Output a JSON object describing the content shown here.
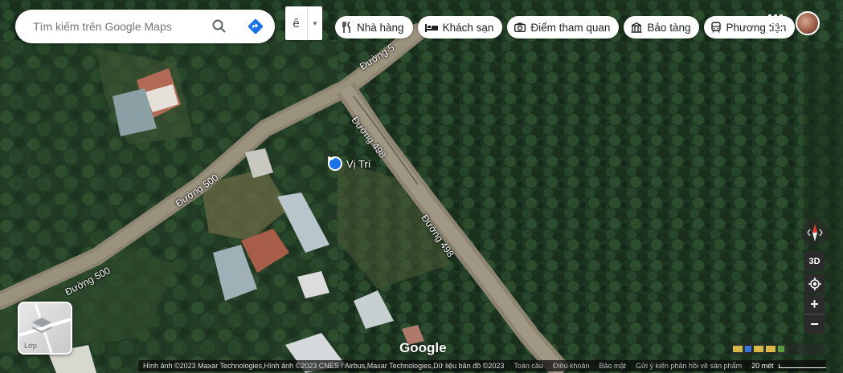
{
  "search": {
    "placeholder": "Tìm kiếm trên Google Maps"
  },
  "layer_dropdown": {
    "glyph": "ê",
    "arrow": "▾"
  },
  "chips": [
    {
      "label": "Nhà hàng",
      "icon": "restaurant-icon"
    },
    {
      "label": "Khách sạn",
      "icon": "hotel-icon"
    },
    {
      "label": "Điểm tham quan",
      "icon": "camera-icon"
    },
    {
      "label": "Bảo tàng",
      "icon": "museum-icon"
    },
    {
      "label": "Phương tiện",
      "icon": "transit-icon"
    }
  ],
  "pin": {
    "label": "Vị Trí",
    "color": "#1a73e8"
  },
  "roads": [
    {
      "name": "Đường 500"
    },
    {
      "name": "Đường 500"
    },
    {
      "name": "Đường 498"
    },
    {
      "name": "Đường 498"
    },
    {
      "name": "Đường 5"
    }
  ],
  "controls": {
    "compass": "compass-icon",
    "three_d": "3D",
    "locate": "my-location-icon",
    "zoom_in": "+",
    "zoom_out": "−"
  },
  "layer_thumb": {
    "label": "Lớp"
  },
  "branding": {
    "logo": "Google"
  },
  "footer": {
    "attribution": "Hình ảnh ©2023 Maxar Technologies,Hình ảnh ©2023 CNES / Airbus,Maxar Technologies,Dữ liệu bản đồ ©2023",
    "links": [
      "Toàn cầu",
      "Điều khoản",
      "Bảo mật",
      "Gửi ý kiến phản hồi về sản phẩm"
    ],
    "scale": "20 mét"
  },
  "colors": {
    "forest": "#1c3320",
    "road": "#8a8370",
    "accent": "#1a73e8"
  }
}
